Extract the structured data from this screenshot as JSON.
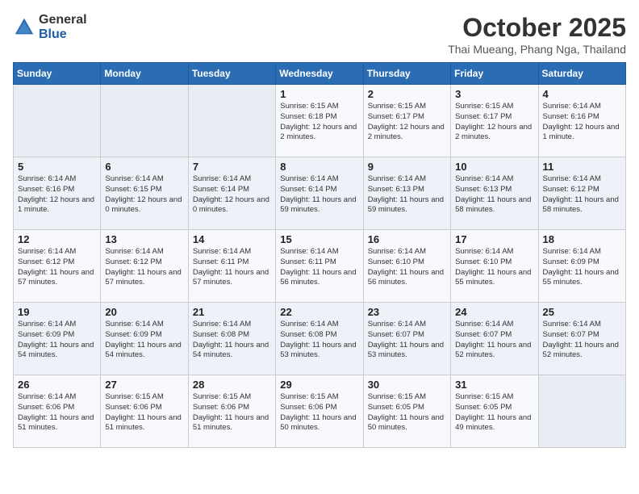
{
  "header": {
    "logo_general": "General",
    "logo_blue": "Blue",
    "title": "October 2025",
    "location": "Thai Mueang, Phang Nga, Thailand"
  },
  "weekdays": [
    "Sunday",
    "Monday",
    "Tuesday",
    "Wednesday",
    "Thursday",
    "Friday",
    "Saturday"
  ],
  "weeks": [
    [
      {
        "day": "",
        "text": ""
      },
      {
        "day": "",
        "text": ""
      },
      {
        "day": "",
        "text": ""
      },
      {
        "day": "1",
        "text": "Sunrise: 6:15 AM\nSunset: 6:18 PM\nDaylight: 12 hours and 2 minutes."
      },
      {
        "day": "2",
        "text": "Sunrise: 6:15 AM\nSunset: 6:17 PM\nDaylight: 12 hours and 2 minutes."
      },
      {
        "day": "3",
        "text": "Sunrise: 6:15 AM\nSunset: 6:17 PM\nDaylight: 12 hours and 2 minutes."
      },
      {
        "day": "4",
        "text": "Sunrise: 6:14 AM\nSunset: 6:16 PM\nDaylight: 12 hours and 1 minute."
      }
    ],
    [
      {
        "day": "5",
        "text": "Sunrise: 6:14 AM\nSunset: 6:16 PM\nDaylight: 12 hours and 1 minute."
      },
      {
        "day": "6",
        "text": "Sunrise: 6:14 AM\nSunset: 6:15 PM\nDaylight: 12 hours and 0 minutes."
      },
      {
        "day": "7",
        "text": "Sunrise: 6:14 AM\nSunset: 6:14 PM\nDaylight: 12 hours and 0 minutes."
      },
      {
        "day": "8",
        "text": "Sunrise: 6:14 AM\nSunset: 6:14 PM\nDaylight: 11 hours and 59 minutes."
      },
      {
        "day": "9",
        "text": "Sunrise: 6:14 AM\nSunset: 6:13 PM\nDaylight: 11 hours and 59 minutes."
      },
      {
        "day": "10",
        "text": "Sunrise: 6:14 AM\nSunset: 6:13 PM\nDaylight: 11 hours and 58 minutes."
      },
      {
        "day": "11",
        "text": "Sunrise: 6:14 AM\nSunset: 6:12 PM\nDaylight: 11 hours and 58 minutes."
      }
    ],
    [
      {
        "day": "12",
        "text": "Sunrise: 6:14 AM\nSunset: 6:12 PM\nDaylight: 11 hours and 57 minutes."
      },
      {
        "day": "13",
        "text": "Sunrise: 6:14 AM\nSunset: 6:12 PM\nDaylight: 11 hours and 57 minutes."
      },
      {
        "day": "14",
        "text": "Sunrise: 6:14 AM\nSunset: 6:11 PM\nDaylight: 11 hours and 57 minutes."
      },
      {
        "day": "15",
        "text": "Sunrise: 6:14 AM\nSunset: 6:11 PM\nDaylight: 11 hours and 56 minutes."
      },
      {
        "day": "16",
        "text": "Sunrise: 6:14 AM\nSunset: 6:10 PM\nDaylight: 11 hours and 56 minutes."
      },
      {
        "day": "17",
        "text": "Sunrise: 6:14 AM\nSunset: 6:10 PM\nDaylight: 11 hours and 55 minutes."
      },
      {
        "day": "18",
        "text": "Sunrise: 6:14 AM\nSunset: 6:09 PM\nDaylight: 11 hours and 55 minutes."
      }
    ],
    [
      {
        "day": "19",
        "text": "Sunrise: 6:14 AM\nSunset: 6:09 PM\nDaylight: 11 hours and 54 minutes."
      },
      {
        "day": "20",
        "text": "Sunrise: 6:14 AM\nSunset: 6:09 PM\nDaylight: 11 hours and 54 minutes."
      },
      {
        "day": "21",
        "text": "Sunrise: 6:14 AM\nSunset: 6:08 PM\nDaylight: 11 hours and 54 minutes."
      },
      {
        "day": "22",
        "text": "Sunrise: 6:14 AM\nSunset: 6:08 PM\nDaylight: 11 hours and 53 minutes."
      },
      {
        "day": "23",
        "text": "Sunrise: 6:14 AM\nSunset: 6:07 PM\nDaylight: 11 hours and 53 minutes."
      },
      {
        "day": "24",
        "text": "Sunrise: 6:14 AM\nSunset: 6:07 PM\nDaylight: 11 hours and 52 minutes."
      },
      {
        "day": "25",
        "text": "Sunrise: 6:14 AM\nSunset: 6:07 PM\nDaylight: 11 hours and 52 minutes."
      }
    ],
    [
      {
        "day": "26",
        "text": "Sunrise: 6:14 AM\nSunset: 6:06 PM\nDaylight: 11 hours and 51 minutes."
      },
      {
        "day": "27",
        "text": "Sunrise: 6:15 AM\nSunset: 6:06 PM\nDaylight: 11 hours and 51 minutes."
      },
      {
        "day": "28",
        "text": "Sunrise: 6:15 AM\nSunset: 6:06 PM\nDaylight: 11 hours and 51 minutes."
      },
      {
        "day": "29",
        "text": "Sunrise: 6:15 AM\nSunset: 6:06 PM\nDaylight: 11 hours and 50 minutes."
      },
      {
        "day": "30",
        "text": "Sunrise: 6:15 AM\nSunset: 6:05 PM\nDaylight: 11 hours and 50 minutes."
      },
      {
        "day": "31",
        "text": "Sunrise: 6:15 AM\nSunset: 6:05 PM\nDaylight: 11 hours and 49 minutes."
      },
      {
        "day": "",
        "text": ""
      }
    ]
  ]
}
